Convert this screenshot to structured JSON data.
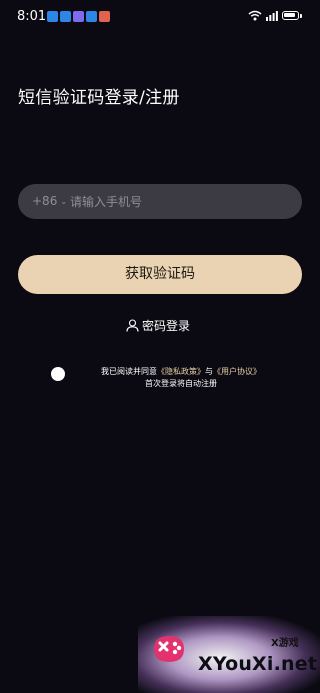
{
  "status_bar": {
    "time": "8:01",
    "notification_icons": [
      {
        "icon": "weather-cloud-icon",
        "color": "#2d86e6"
      },
      {
        "icon": "weather-cloud-icon",
        "color": "#2d86e6"
      },
      {
        "icon": "gallery-app-icon",
        "color": "#7b6cf0"
      },
      {
        "icon": "weather-cloud-icon",
        "color": "#2d86e6"
      },
      {
        "icon": "app-notification-icon",
        "color": "#e0624f"
      }
    ],
    "signal_label": "5G"
  },
  "page": {
    "title": "短信验证码登录/注册"
  },
  "phone_field": {
    "country_code": "+86",
    "placeholder": "请输入手机号",
    "value": ""
  },
  "get_code_button": {
    "label": "获取验证码"
  },
  "password_login": {
    "label": "密码登录"
  },
  "agreement": {
    "prefix": "我已阅读并同意",
    "privacy_link": "《隐私政策》",
    "joiner": "与",
    "user_agreement_link": "《用户协议》",
    "note": "首次登录将自动注册"
  },
  "watermark": {
    "small_text": "X游戏",
    "big_text": "XYouXi.net"
  },
  "colors": {
    "background": "#0b0a12",
    "input_background": "#3c3b44",
    "accent_button": "#ead3b2",
    "link": "#e8cfa7"
  }
}
